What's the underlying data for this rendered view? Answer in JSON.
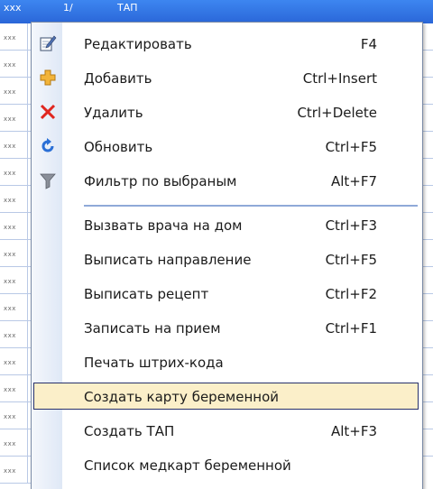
{
  "grid": {
    "header_left": "xxx",
    "header_col1": "1/",
    "header_col2": "ТАП",
    "cell_text": "xxx"
  },
  "menu": {
    "items": [
      {
        "label": "Редактировать",
        "shortcut": "F4",
        "icon": "edit-icon"
      },
      {
        "label": "Добавить",
        "shortcut": "Ctrl+Insert",
        "icon": "plus-icon"
      },
      {
        "label": "Удалить",
        "shortcut": "Ctrl+Delete",
        "icon": "delete-x-icon"
      },
      {
        "label": "Обновить",
        "shortcut": "Ctrl+F5",
        "icon": "refresh-icon"
      },
      {
        "label": "Фильтр по выбраным",
        "shortcut": "Alt+F7",
        "icon": "filter-icon"
      },
      {
        "label": "Вызвать врача на дом",
        "shortcut": "Ctrl+F3"
      },
      {
        "label": "Выписать направление",
        "shortcut": "Ctrl+F5"
      },
      {
        "label": "Выписать рецепт",
        "shortcut": "Ctrl+F2"
      },
      {
        "label": "Записать на прием",
        "shortcut": "Ctrl+F1"
      },
      {
        "label": "Печать штрих-кода",
        "shortcut": ""
      },
      {
        "label": "Создать карту беременной",
        "shortcut": "",
        "highlighted": true
      },
      {
        "label": "Создать ТАП",
        "shortcut": "Alt+F3"
      },
      {
        "label": "Список медкарт беременной",
        "shortcut": ""
      }
    ]
  },
  "colors": {
    "header_blue": "#2a66d8",
    "highlight_fill": "#fbefc9",
    "highlight_border": "#27306a",
    "separator": "#8fa9d8",
    "plus_icon": "#f2b43a",
    "delete_icon": "#e0261f",
    "refresh_icon": "#2a6fd6",
    "filter_icon": "#8a8f99"
  }
}
